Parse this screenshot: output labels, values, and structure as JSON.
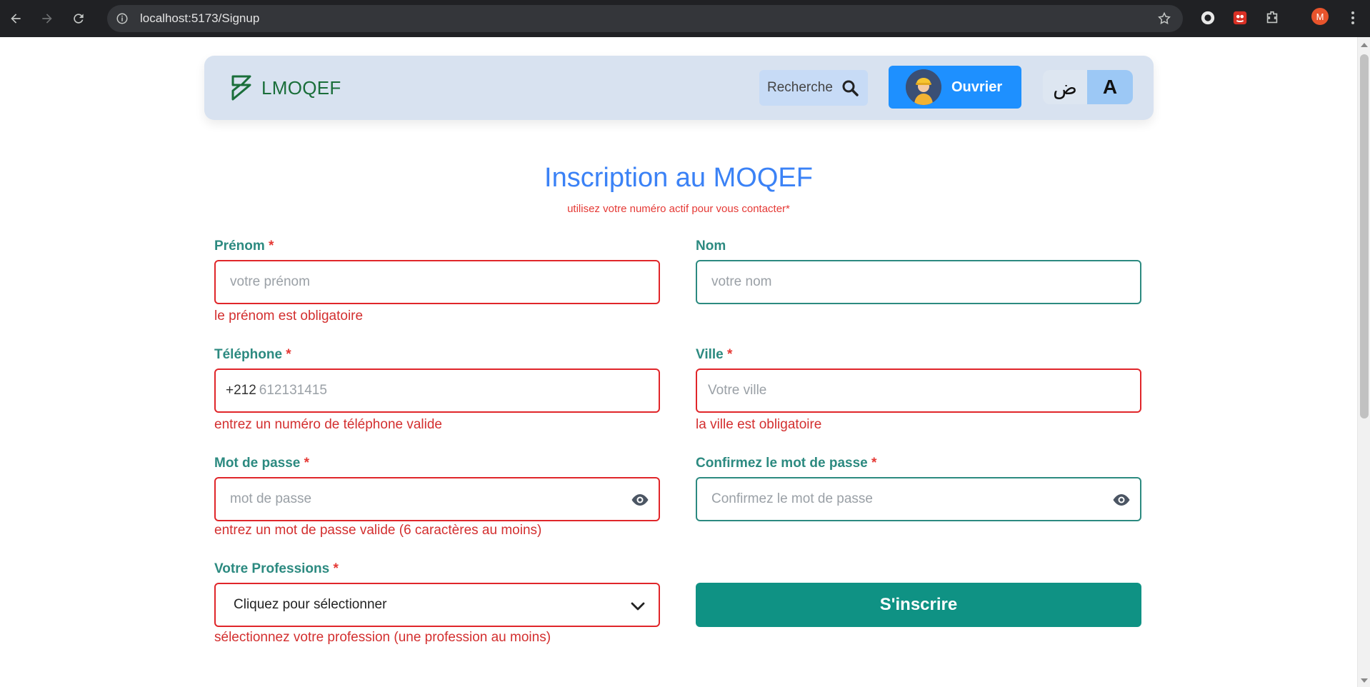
{
  "browser": {
    "url": "localhost:5173/Signup",
    "profile_initial": "M"
  },
  "navbar": {
    "brand": "LMOQEF",
    "search_label": "Recherche",
    "worker_label": "Ouvrier",
    "lang_ar": "ض",
    "lang_fr": "A"
  },
  "page": {
    "title": "Inscription au MOQEF",
    "subtitle": "utilisez votre numéro actif pour vous contacter*"
  },
  "form": {
    "required_mark": "*",
    "first_name": {
      "label": "Prénom",
      "placeholder": "votre prénom",
      "error": "le prénom est obligatoire"
    },
    "last_name": {
      "label": "Nom",
      "placeholder": "votre nom"
    },
    "phone": {
      "label": "Téléphone",
      "prefix": "+212",
      "placeholder": "612131415",
      "error": "entrez un numéro de téléphone valide"
    },
    "city": {
      "label": "Ville",
      "placeholder": "Votre ville",
      "error": "la ville est obligatoire"
    },
    "password": {
      "label": "Mot de passe",
      "placeholder": "mot de passe",
      "error": "entrez un mot de passe valide (6 caractères au moins)"
    },
    "confirm_password": {
      "label": "Confirmez le mot de passe",
      "placeholder": "Confirmez le mot de passe"
    },
    "profession": {
      "label": "Votre Professions",
      "value": "Cliquez pour sélectionner",
      "error": "sélectionnez votre profession (une profession au moins)"
    },
    "submit_label": "S'inscrire"
  },
  "colors": {
    "accent": "#0f9284",
    "title_blue": "#3b82f6",
    "error_red": "#e0262a",
    "worker_blue": "#1e90ff"
  }
}
